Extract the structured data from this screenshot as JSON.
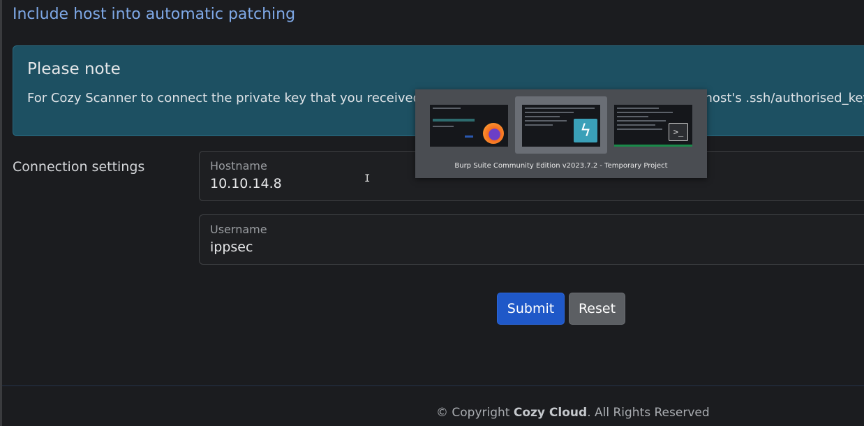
{
  "page": {
    "title": "Include host into automatic patching"
  },
  "note": {
    "title": "Please note",
    "text": "For Cozy Scanner to connect the private key that you received upon registration has to be included in your host's .ssh/authorised_keys file."
  },
  "connection": {
    "section_label": "Connection settings",
    "hostname_label": "Hostname",
    "hostname_value": "10.10.14.8",
    "username_label": "Username",
    "username_value": "ippsec"
  },
  "buttons": {
    "submit_label": "Submit",
    "reset_label": "Reset"
  },
  "footer": {
    "prefix": "© Copyright ",
    "brand": "Cozy Cloud",
    "suffix": ". All Rights Reserved"
  },
  "window_switcher": {
    "caption": "Burp Suite Community Edition v2023.7.2 - Temporary Project",
    "windows": [
      {
        "app_icon": "firefox-icon"
      },
      {
        "app_icon": "burp-suite-icon",
        "selected": true
      },
      {
        "app_icon": "terminal-icon"
      }
    ]
  },
  "colors": {
    "title_accent": "#7ea8e6",
    "note_background": "#1d5062",
    "submit_button": "#1f58c8",
    "reset_button": "#5c5f63"
  }
}
